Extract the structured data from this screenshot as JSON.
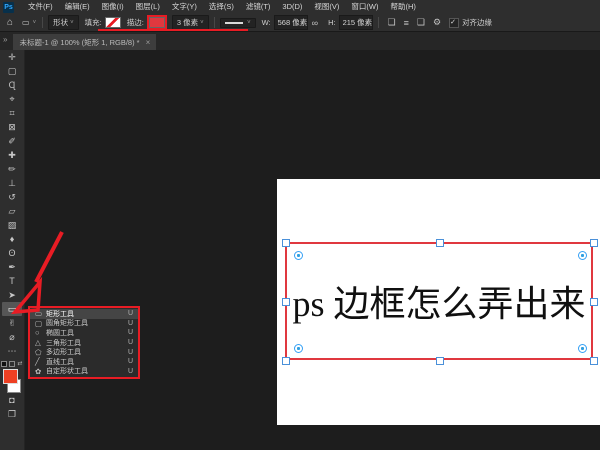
{
  "colors": {
    "annotation_red": "#e81c24",
    "stroke_red": "#e0383f",
    "foreground_red": "#ee4023",
    "canvas_surround": "#1d1d1d"
  },
  "window": {
    "logo": "Ps"
  },
  "menu_bar": {
    "items": [
      {
        "label": "文件(F)"
      },
      {
        "label": "编辑(E)"
      },
      {
        "label": "图像(I)"
      },
      {
        "label": "图层(L)"
      },
      {
        "label": "文字(Y)"
      },
      {
        "label": "选择(S)"
      },
      {
        "label": "滤镜(T)"
      },
      {
        "label": "3D(D)"
      },
      {
        "label": "视图(V)"
      },
      {
        "label": "窗口(W)"
      },
      {
        "label": "帮助(H)"
      }
    ]
  },
  "options_bar": {
    "tool_mode": "形状",
    "fill_label": "填充:",
    "stroke_label": "描边:",
    "stroke_width": "3 像素",
    "w_label": "W:",
    "w_value": "568 像素",
    "h_label": "H:",
    "h_value": "215 像素",
    "align_edges_label": "对齐边缘",
    "glyphs": {
      "home": "⌂",
      "preset_rect": "▭",
      "caret": "˅",
      "link": "∞",
      "path_ops": "❏",
      "align": "≡",
      "arrange": "❑",
      "gear": "⚙",
      "check": "✓"
    }
  },
  "document_tab": {
    "title": "未标题-1 @ 100% (矩形 1, RGB/8) *",
    "close_glyph": "×",
    "chevrons_glyph": "»"
  },
  "toolbar": {
    "tools_top": [
      {
        "name": "move-tool",
        "glyph": "✛"
      },
      {
        "name": "rectangular-marquee-tool",
        "glyph": "▢"
      },
      {
        "name": "lasso-tool",
        "glyph": "Ɋ"
      },
      {
        "name": "object-selection-tool",
        "glyph": "⌖"
      },
      {
        "name": "crop-tool",
        "glyph": "⌗"
      },
      {
        "name": "frame-tool",
        "glyph": "⊠"
      },
      {
        "name": "eyedropper-tool",
        "glyph": "✐"
      },
      {
        "name": "spot-healing-brush-tool",
        "glyph": "✚"
      },
      {
        "name": "brush-tool",
        "glyph": "✏"
      },
      {
        "name": "clone-stamp-tool",
        "glyph": "⊥"
      },
      {
        "name": "history-brush-tool",
        "glyph": "↺"
      },
      {
        "name": "eraser-tool",
        "glyph": "▱"
      },
      {
        "name": "gradient-tool",
        "glyph": "▨"
      },
      {
        "name": "blur-tool",
        "glyph": "♦"
      },
      {
        "name": "dodge-tool",
        "glyph": "ʘ"
      },
      {
        "name": "pen-tool",
        "glyph": "✒"
      },
      {
        "name": "type-tool",
        "glyph": "T"
      },
      {
        "name": "path-selection-tool",
        "glyph": "➤"
      },
      {
        "name": "rectangle-tool",
        "glyph": "▭",
        "active": true
      },
      {
        "name": "hand-tool",
        "glyph": "✌"
      },
      {
        "name": "zoom-tool",
        "glyph": "⌀"
      },
      {
        "name": "edit-toolbar-button",
        "glyph": "⋯"
      }
    ],
    "tools_bottom": [
      {
        "name": "quick-mask-button",
        "glyph": "◘"
      },
      {
        "name": "screen-mode-button",
        "glyph": "❐"
      }
    ],
    "swap_glyph": "⇄"
  },
  "shape_tools_flyout": {
    "items": [
      {
        "name": "flyout-rectangle-tool",
        "glyph": "▭",
        "label": "矩形工具",
        "shortcut": "U",
        "selected": true
      },
      {
        "name": "flyout-rounded-rectangle-tool",
        "glyph": "▢",
        "label": "圆角矩形工具",
        "shortcut": "U"
      },
      {
        "name": "flyout-ellipse-tool",
        "glyph": "○",
        "label": "椭圆工具",
        "shortcut": "U"
      },
      {
        "name": "flyout-triangle-tool",
        "glyph": "△",
        "label": "三角形工具",
        "shortcut": "U"
      },
      {
        "name": "flyout-polygon-tool",
        "glyph": "⬠",
        "label": "多边形工具",
        "shortcut": "U"
      },
      {
        "name": "flyout-line-tool",
        "glyph": "╱",
        "label": "直线工具",
        "shortcut": "U"
      },
      {
        "name": "flyout-custom-shape-tool",
        "glyph": "✿",
        "label": "自定形状工具",
        "shortcut": "U"
      }
    ]
  },
  "canvas": {
    "text": "ps 边框怎么弄出来"
  }
}
